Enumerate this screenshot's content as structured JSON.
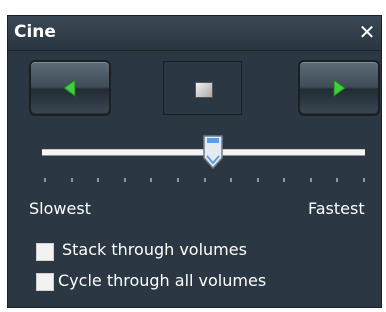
{
  "window": {
    "title": "Cine",
    "close_glyph": "✕"
  },
  "controls": {
    "back_icon": "play-left-icon",
    "forward_icon": "play-right-icon",
    "stop_icon": "stop-icon"
  },
  "speed": {
    "min_label": "Slowest",
    "max_label": "Fastest",
    "value_fraction": 0.53,
    "tick_count": 13
  },
  "options": [
    {
      "label": "Stack through volumes",
      "checked": false
    },
    {
      "label": "Cycle through all volumes",
      "checked": false
    }
  ],
  "colors": {
    "panel_bg": "#2b3742",
    "arrow_green": "#3fcf3f"
  }
}
